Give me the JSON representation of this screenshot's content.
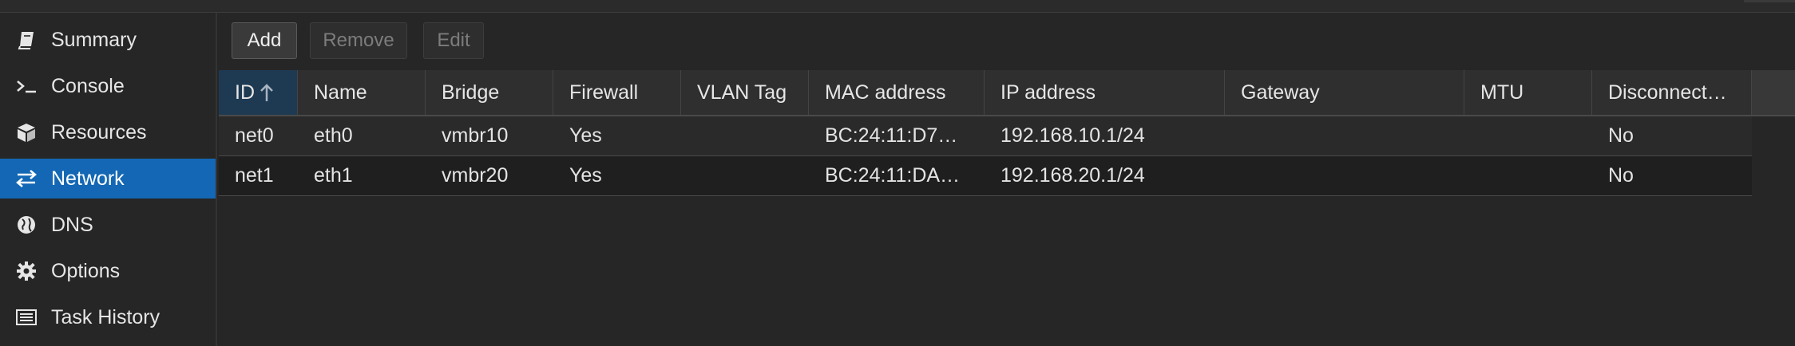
{
  "sidebar": {
    "items": [
      {
        "label": "Summary",
        "icon": "book-icon"
      },
      {
        "label": "Console",
        "icon": "terminal-icon"
      },
      {
        "label": "Resources",
        "icon": "cube-icon"
      },
      {
        "label": "Network",
        "icon": "exchange-icon",
        "active": true
      },
      {
        "label": "DNS",
        "icon": "globe-icon"
      },
      {
        "label": "Options",
        "icon": "gear-icon"
      },
      {
        "label": "Task History",
        "icon": "list-icon"
      }
    ]
  },
  "toolbar": {
    "add_label": "Add",
    "remove_label": "Remove",
    "edit_label": "Edit"
  },
  "table": {
    "columns": [
      "ID",
      "Name",
      "Bridge",
      "Firewall",
      "VLAN Tag",
      "MAC address",
      "IP address",
      "Gateway",
      "MTU",
      "Disconnect…"
    ],
    "sort_icon": "arrow-up-icon",
    "rows": [
      [
        "net0",
        "eth0",
        "vmbr10",
        "Yes",
        "",
        "BC:24:11:D7…",
        "192.168.10.1/24",
        "",
        "",
        "No"
      ],
      [
        "net1",
        "eth1",
        "vmbr20",
        "Yes",
        "",
        "BC:24:11:DA…",
        "192.168.20.1/24",
        "",
        "",
        "No"
      ]
    ]
  },
  "colors": {
    "accent": "#1367b4",
    "sorted_header": "#1e3a52",
    "background": "#262626"
  }
}
